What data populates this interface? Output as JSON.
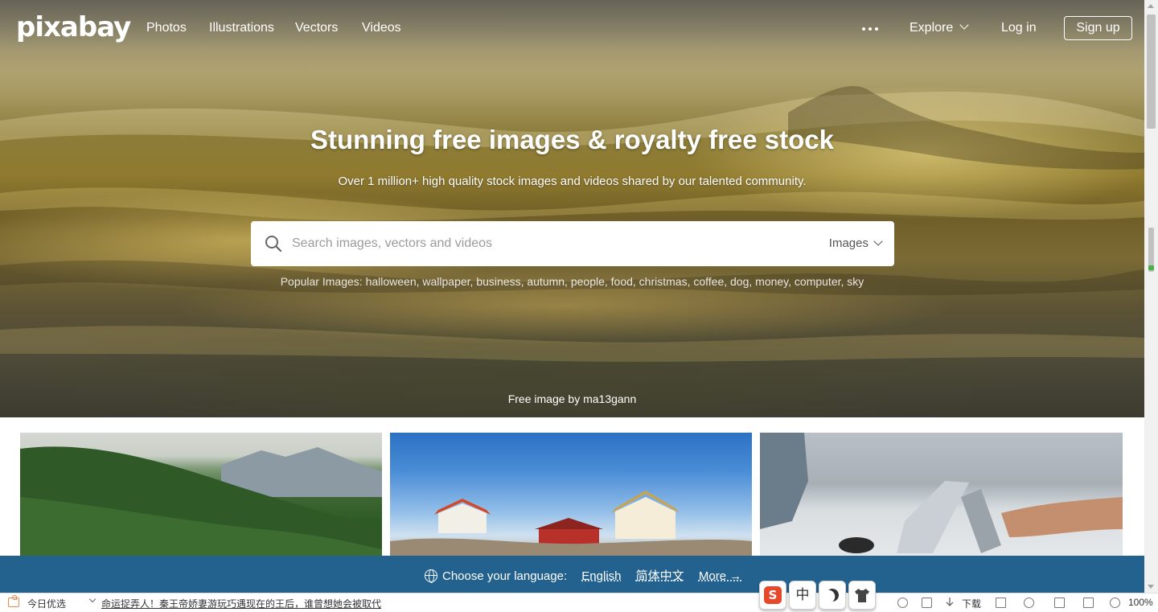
{
  "nav": {
    "logo": "pixabay",
    "links": [
      "Photos",
      "Illustrations",
      "Vectors",
      "Videos"
    ],
    "explore": "Explore",
    "login": "Log in",
    "signup": "Sign up"
  },
  "hero": {
    "title": "Stunning free images & royalty free stock",
    "subtitle": "Over 1 million+ high quality stock images and videos shared by our talented community.",
    "search_placeholder": "Search images, vectors and videos",
    "search_type": "Images",
    "popular_label": "Popular Images:",
    "popular_terms": "halloween, wallpaper, business, autumn, people, food, christmas, coffee, dog, money, computer, sky",
    "credit": "Free image by ma13gann"
  },
  "language_bar": {
    "label": "Choose your language:",
    "options": [
      "English",
      "简体中文",
      "More →"
    ],
    "bg_color": "#23628f"
  },
  "statusbar": {
    "today": "今日优选",
    "news": "命运捉弄人！秦王帝娇妻游玩巧遇现在的王后，谁曾想她会被取代",
    "download": "下载",
    "zoom": "100%"
  },
  "ime": {
    "sogou": "S",
    "lang": "中"
  }
}
